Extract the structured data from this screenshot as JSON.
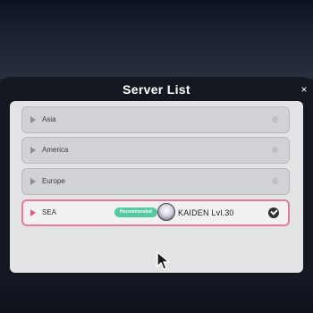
{
  "dialog": {
    "title": "Server List",
    "close_label": "×"
  },
  "servers": [
    {
      "name": "Asia",
      "selected": false
    },
    {
      "name": "America",
      "selected": false
    },
    {
      "name": "Europe",
      "selected": false
    },
    {
      "name": "SEA",
      "selected": true,
      "badge": "Recommended",
      "player": "KAIDEN  Lvl.30"
    }
  ],
  "colors": {
    "selected_border": "#e8799a",
    "badge_bg": "#55c9a4",
    "panel_bg": "#e2e3e5",
    "dialog_bg": "#131820"
  },
  "icons": {
    "close": "close-icon",
    "row_arrow": "play-arrow-icon",
    "selected_check": "check-icon",
    "avatar": "avatar-icon",
    "cursor": "mouse-cursor-icon"
  }
}
